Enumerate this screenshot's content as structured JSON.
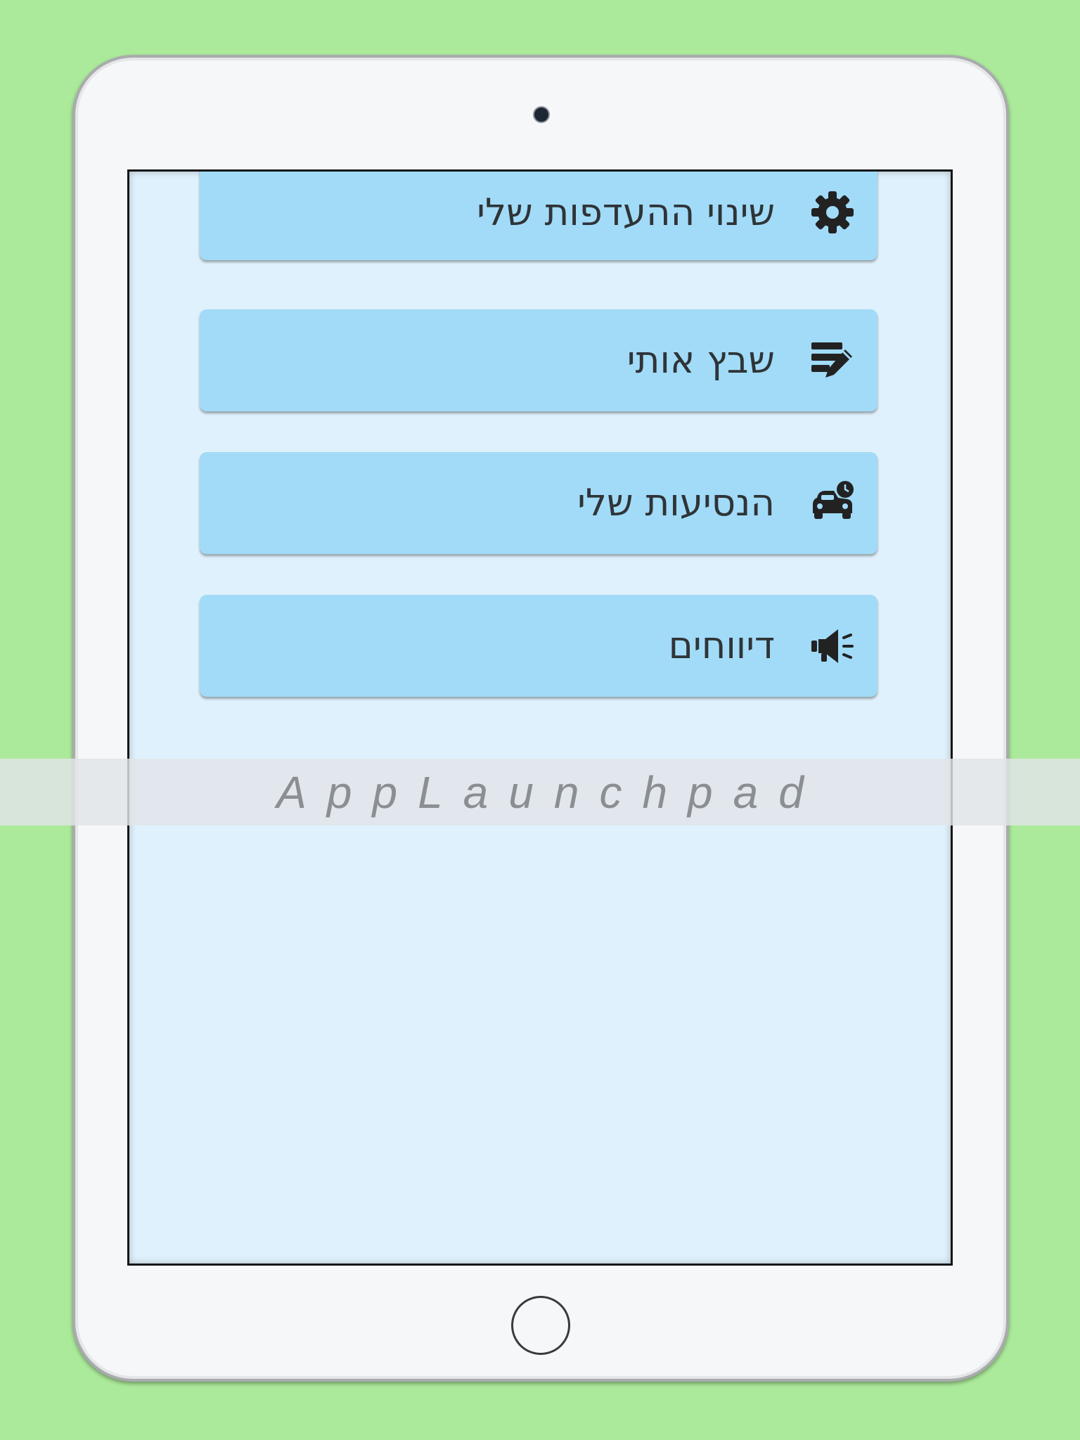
{
  "menu": {
    "items": [
      {
        "label": "שינוי ההעדפות שלי",
        "icon": "gear-icon"
      },
      {
        "label": "שבץ אותי",
        "icon": "edit-note-icon"
      },
      {
        "label": "הנסיעות שלי",
        "icon": "car-clock-icon"
      },
      {
        "label": "דיווחים",
        "icon": "megaphone-icon"
      }
    ]
  },
  "watermark": {
    "text": "AppLaunchpad"
  },
  "colors": {
    "background": "#acea9b",
    "screen": "#dff1fc",
    "button": "#a1dbf8",
    "text": "#2f3437"
  }
}
